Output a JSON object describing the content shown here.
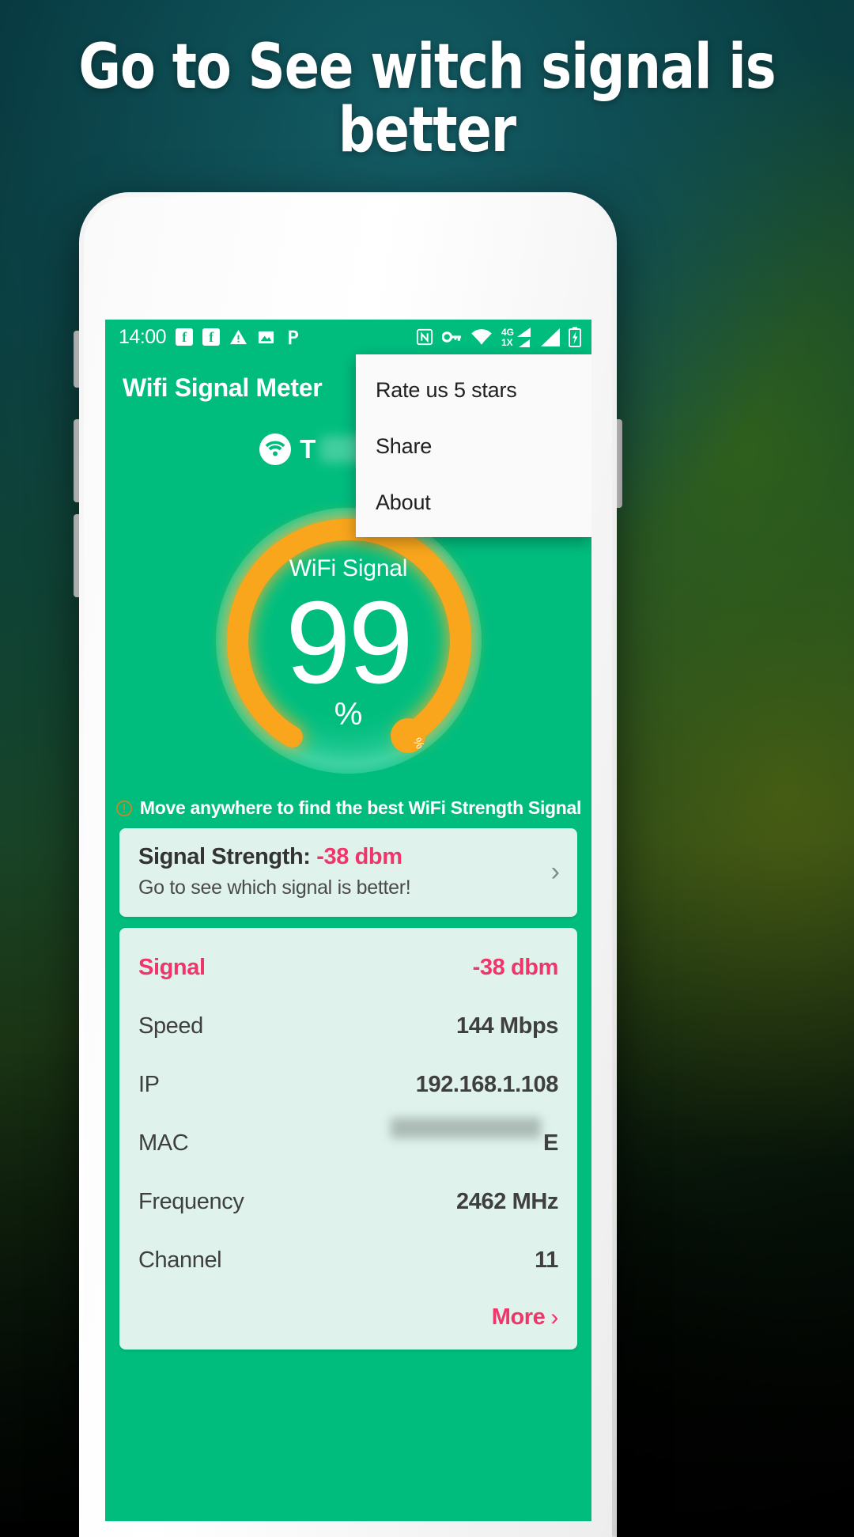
{
  "promo": {
    "headline": "Go to See witch signal is better"
  },
  "status_bar": {
    "time": "14:00",
    "left_icons": [
      "facebook-icon",
      "facebook-icon",
      "warning-triangle-icon",
      "image-icon",
      "pinterest-icon"
    ],
    "right_icons": [
      "nfc-icon",
      "vpn-key-icon",
      "wifi-icon",
      "signal-4g-icon",
      "signal-1x-icon",
      "signal-bars-icon",
      "battery-charging-icon"
    ],
    "network_labels": {
      "primary": "4G",
      "secondary": "1X"
    }
  },
  "app_bar": {
    "title": "Wifi Signal Meter"
  },
  "overflow_menu": {
    "items": [
      {
        "label": "Rate us 5 stars"
      },
      {
        "label": "Share"
      },
      {
        "label": "About"
      }
    ]
  },
  "ssid": {
    "icon": "wifi-icon",
    "name": "T",
    "redacted": true
  },
  "gauge": {
    "caption": "WiFi Signal",
    "value": "99",
    "unit": "%",
    "end_label": "%",
    "arc_color": "#F9A61C",
    "track_color": "#00BD7E",
    "percent": 99
  },
  "hint": {
    "icon": "info-icon",
    "text": "Move anywhere to find the best WiFi Strength Signal"
  },
  "strength_card": {
    "label": "Signal Strength:",
    "value": "-38 dbm",
    "subtitle": "Go to see which signal is better!",
    "chevron": "chevron-right-icon"
  },
  "details": {
    "rows": [
      {
        "key": "Signal",
        "value": "-38 dbm",
        "accent": true,
        "redacted": false
      },
      {
        "key": "Speed",
        "value": "144 Mbps",
        "accent": false,
        "redacted": false
      },
      {
        "key": "IP",
        "value": "192.168.1.108",
        "accent": false,
        "redacted": false
      },
      {
        "key": "MAC",
        "value": "E",
        "accent": false,
        "redacted": true
      },
      {
        "key": "Frequency",
        "value": "2462 MHz",
        "accent": false,
        "redacted": false
      },
      {
        "key": "Channel",
        "value": "11",
        "accent": false,
        "redacted": false
      }
    ],
    "more_label": "More",
    "more_chevron": "chevron-right-icon"
  },
  "colors": {
    "brand_green": "#00BD7E",
    "card_bg": "#DFF3EC",
    "accent_pink": "#F0356B",
    "gauge_orange": "#F9A61C"
  }
}
